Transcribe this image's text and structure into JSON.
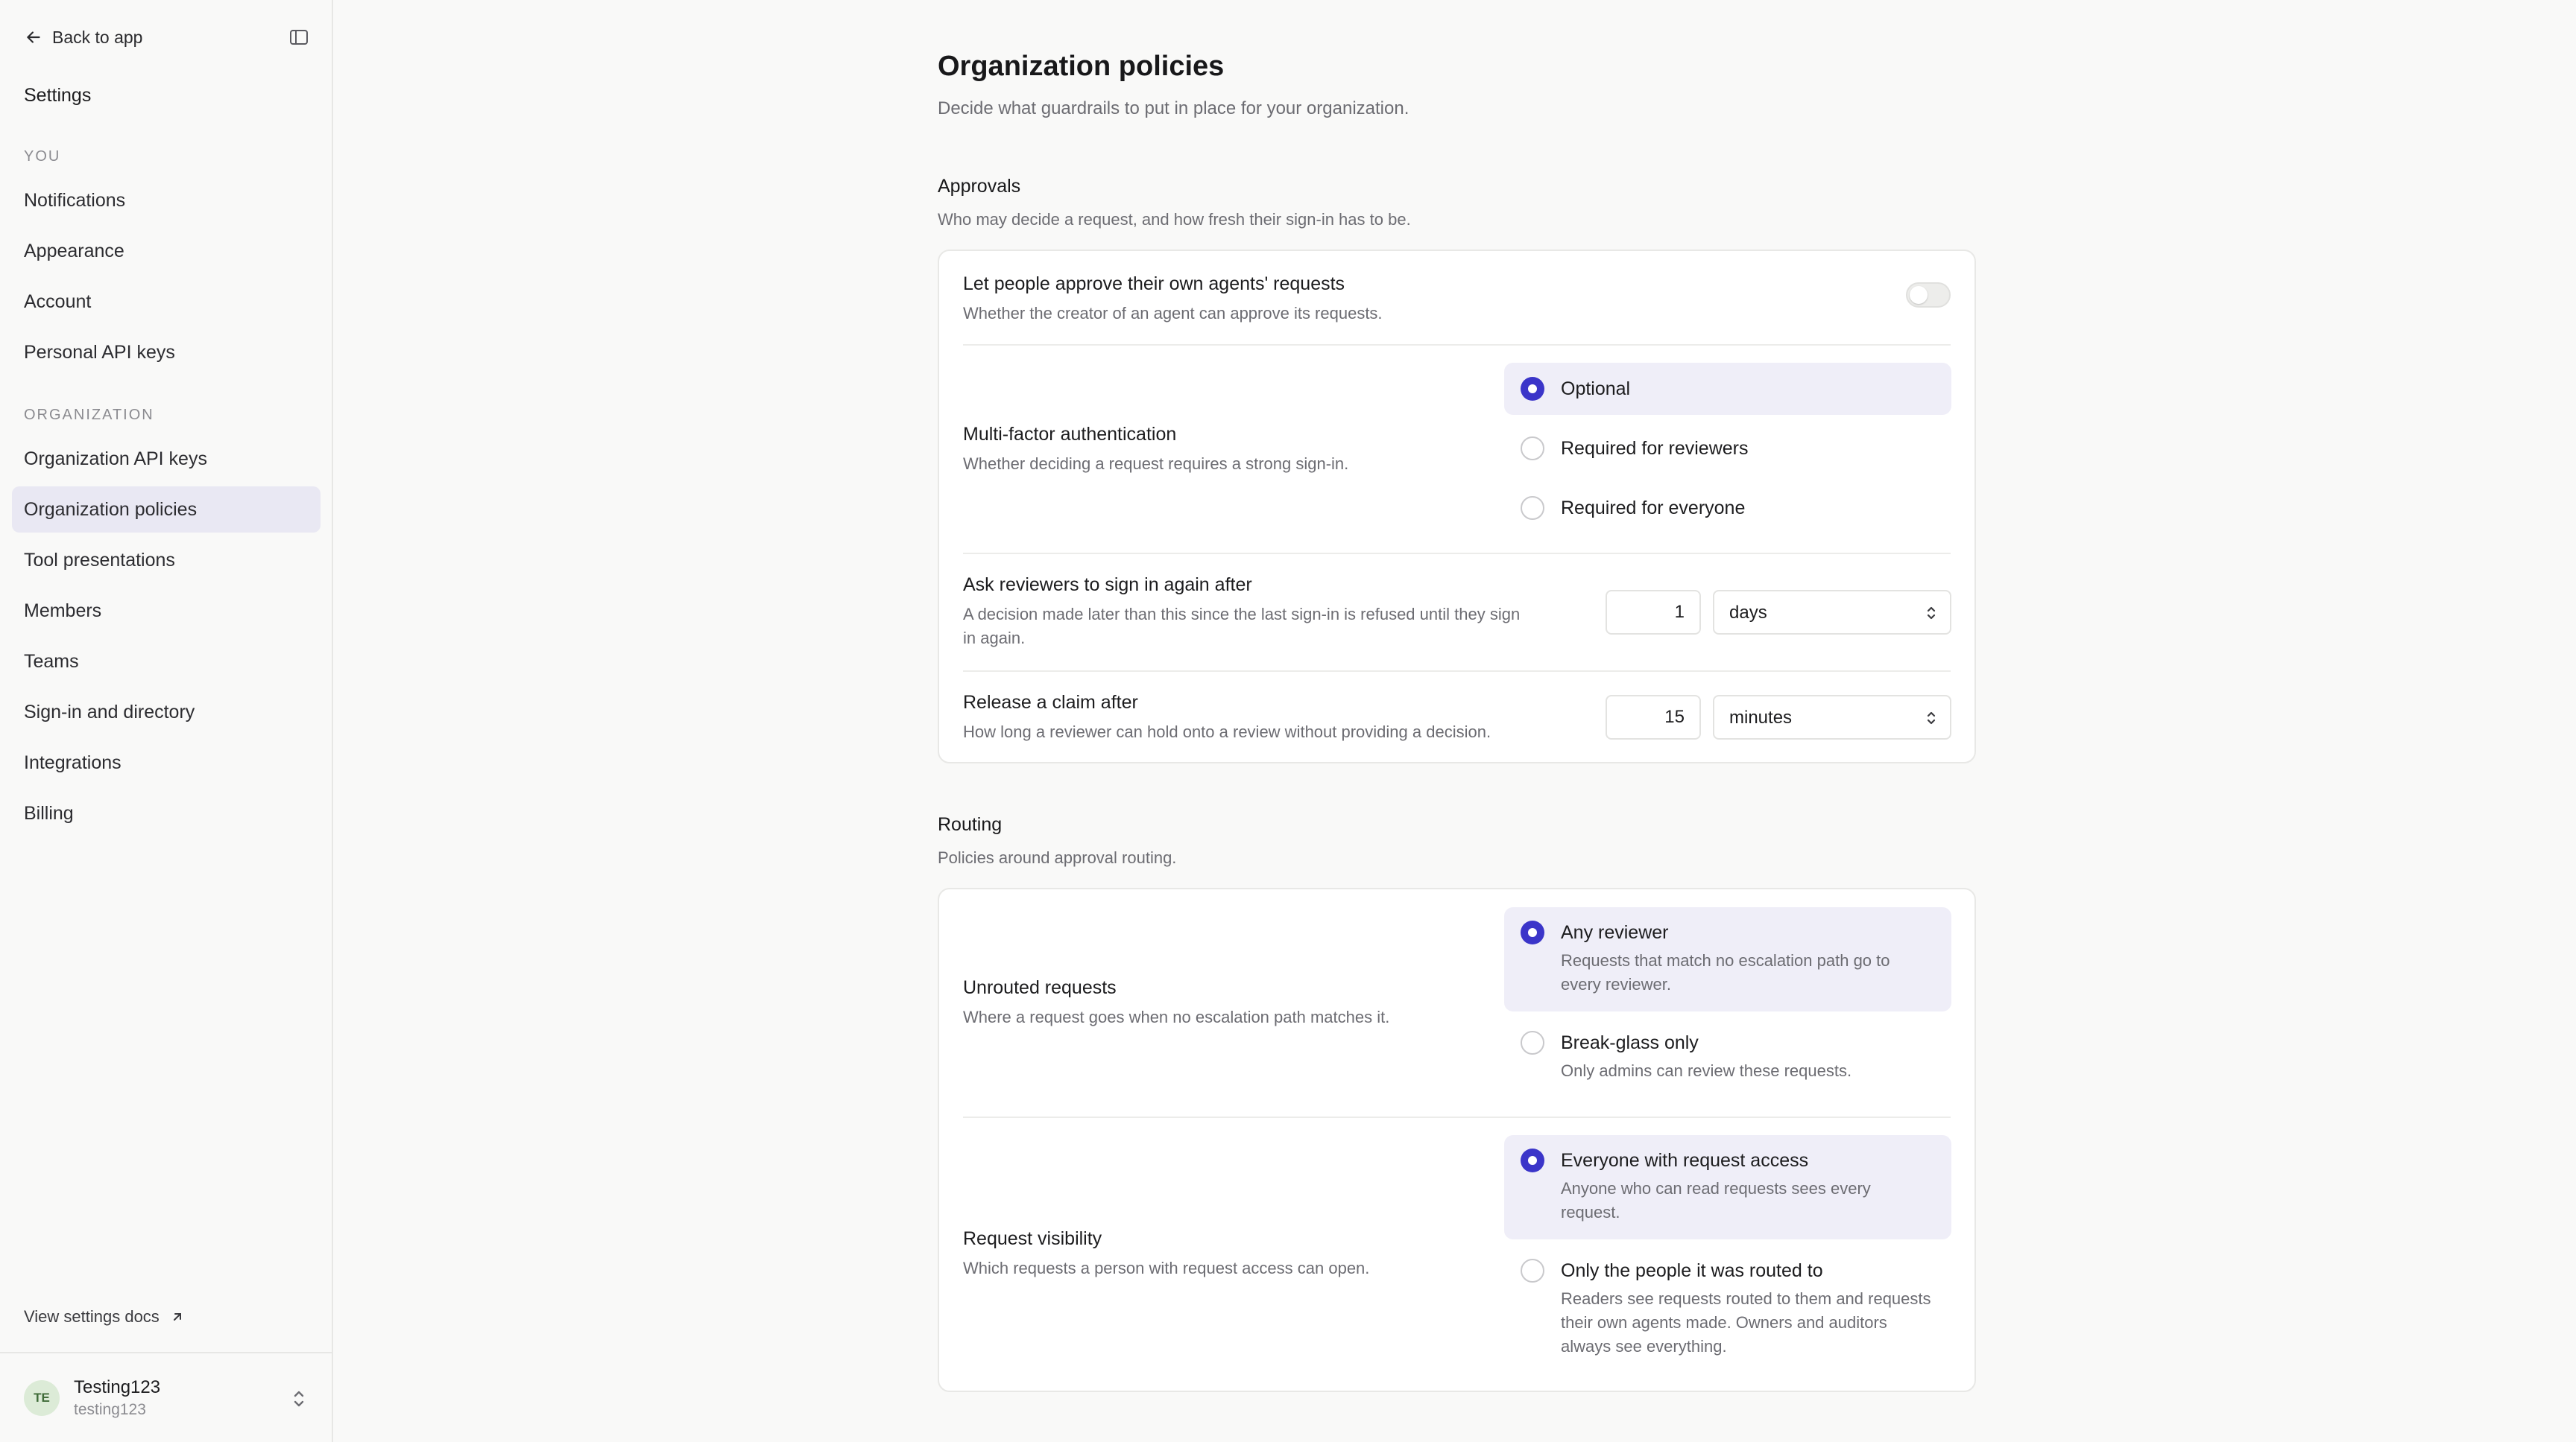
{
  "sidebar": {
    "back_label": "Back to app",
    "title": "Settings",
    "you_label": "YOU",
    "you_items": [
      "Notifications",
      "Appearance",
      "Account",
      "Personal API keys"
    ],
    "org_label": "ORGANIZATION",
    "org_items": [
      "Organization API keys",
      "Organization policies",
      "Tool presentations",
      "Members",
      "Teams",
      "Sign-in and directory",
      "Integrations",
      "Billing"
    ],
    "active_item": "Organization policies",
    "docs_label": "View settings docs",
    "user": {
      "initials": "TE",
      "name": "Testing123",
      "handle": "testing123"
    }
  },
  "main": {
    "title": "Organization policies",
    "subtitle": "Decide what guardrails to put in place for your organization.",
    "approvals": {
      "title": "Approvals",
      "subtitle": "Who may decide a request, and how fresh their sign-in has to be.",
      "self_approve": {
        "title": "Let people approve their own agents' requests",
        "desc": "Whether the creator of an agent can approve its requests.",
        "enabled": false
      },
      "mfa": {
        "title": "Multi-factor authentication",
        "desc": "Whether deciding a request requires a strong sign-in.",
        "options": [
          "Optional",
          "Required for reviewers",
          "Required for everyone"
        ],
        "selected": "Optional"
      },
      "reauth": {
        "title": "Ask reviewers to sign in again after",
        "desc": "A decision made later than this since the last sign-in is refused until they sign in again.",
        "value": "1",
        "unit": "days"
      },
      "claim": {
        "title": "Release a claim after",
        "desc": "How long a reviewer can hold onto a review without providing a decision.",
        "value": "15",
        "unit": "minutes"
      }
    },
    "routing": {
      "title": "Routing",
      "subtitle": "Policies around approval routing.",
      "unrouted": {
        "title": "Unrouted requests",
        "desc": "Where a request goes when no escalation path matches it.",
        "options": [
          {
            "label": "Any reviewer",
            "desc": "Requests that match no escalation path go to every reviewer."
          },
          {
            "label": "Break-glass only",
            "desc": "Only admins can review these requests."
          }
        ],
        "selected": "Any reviewer"
      },
      "visibility": {
        "title": "Request visibility",
        "desc": "Which requests a person with request access can open.",
        "options": [
          {
            "label": "Everyone with request access",
            "desc": "Anyone who can read requests sees every request."
          },
          {
            "label": "Only the people it was routed to",
            "desc": "Readers see requests routed to them and requests their own agents made. Owners and auditors always see everything."
          }
        ],
        "selected": "Everyone with request access"
      }
    }
  },
  "colors": {
    "accent": "#3b35c9",
    "selected_bg": "#efeef8",
    "active_nav_bg": "#e9e8f3"
  }
}
